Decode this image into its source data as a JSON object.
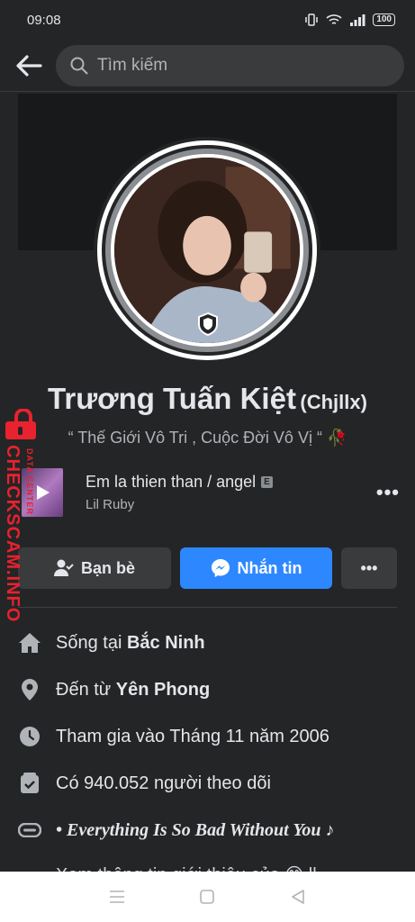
{
  "status": {
    "time": "09:08",
    "battery": "100"
  },
  "search": {
    "placeholder": "Tìm kiếm"
  },
  "profile": {
    "name": "Trương Tuấn Kiệt",
    "alt_name": "(Chjllx)",
    "bio": "“ Thế Giới Vô Tri , Cuộc Đời Vô Vị “",
    "bio_emoji": "🥀"
  },
  "song": {
    "title": "Em la thien than / angel",
    "explicit": "E",
    "artist": "Lil Ruby",
    "more": "•••"
  },
  "actions": {
    "friends_label": "Bạn bè",
    "message_label": "Nhắn tin",
    "more_label": "•••"
  },
  "info": {
    "lives_prefix": "Sống tại",
    "lives_place": "Bắc Ninh",
    "from_prefix": "Đến từ",
    "from_place": "Yên Phong",
    "joined": "Tham gia vào Tháng 11 năm 2006",
    "followers": "Có 940.052 người theo dõi",
    "quote": "• Everything Is So Bad Without You ♪",
    "partial": "Xem thông tin giới thiệu của 😊 ll..."
  },
  "watermark": {
    "main": "CHECKSCAM.INFO",
    "sub": "DATA CENTER"
  },
  "colors": {
    "accent": "#2d88ff",
    "background": "#242526",
    "watermark": "#e8222e"
  }
}
